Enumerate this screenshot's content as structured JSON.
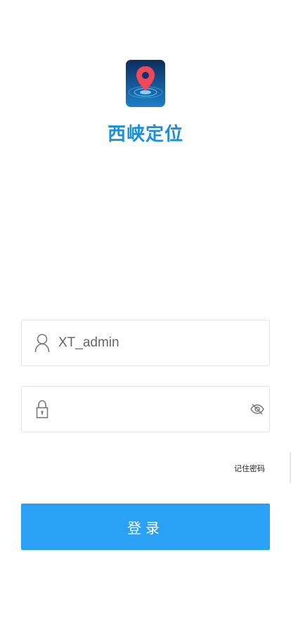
{
  "app": {
    "name": "西峡定位",
    "logo_icon": "map-pin-radar-icon"
  },
  "login_form": {
    "username": {
      "icon": "user-icon",
      "value": "XT_admin"
    },
    "password": {
      "icon": "lock-icon",
      "value": "",
      "visibility_icon": "eye-off-icon"
    },
    "remember_password_label": "记住密码",
    "submit_label": "登录"
  },
  "colors": {
    "brand": "#1c8fd8",
    "button": "#2ba1f5",
    "pin": "#f0475b",
    "field_border": "#e3e3e3"
  }
}
